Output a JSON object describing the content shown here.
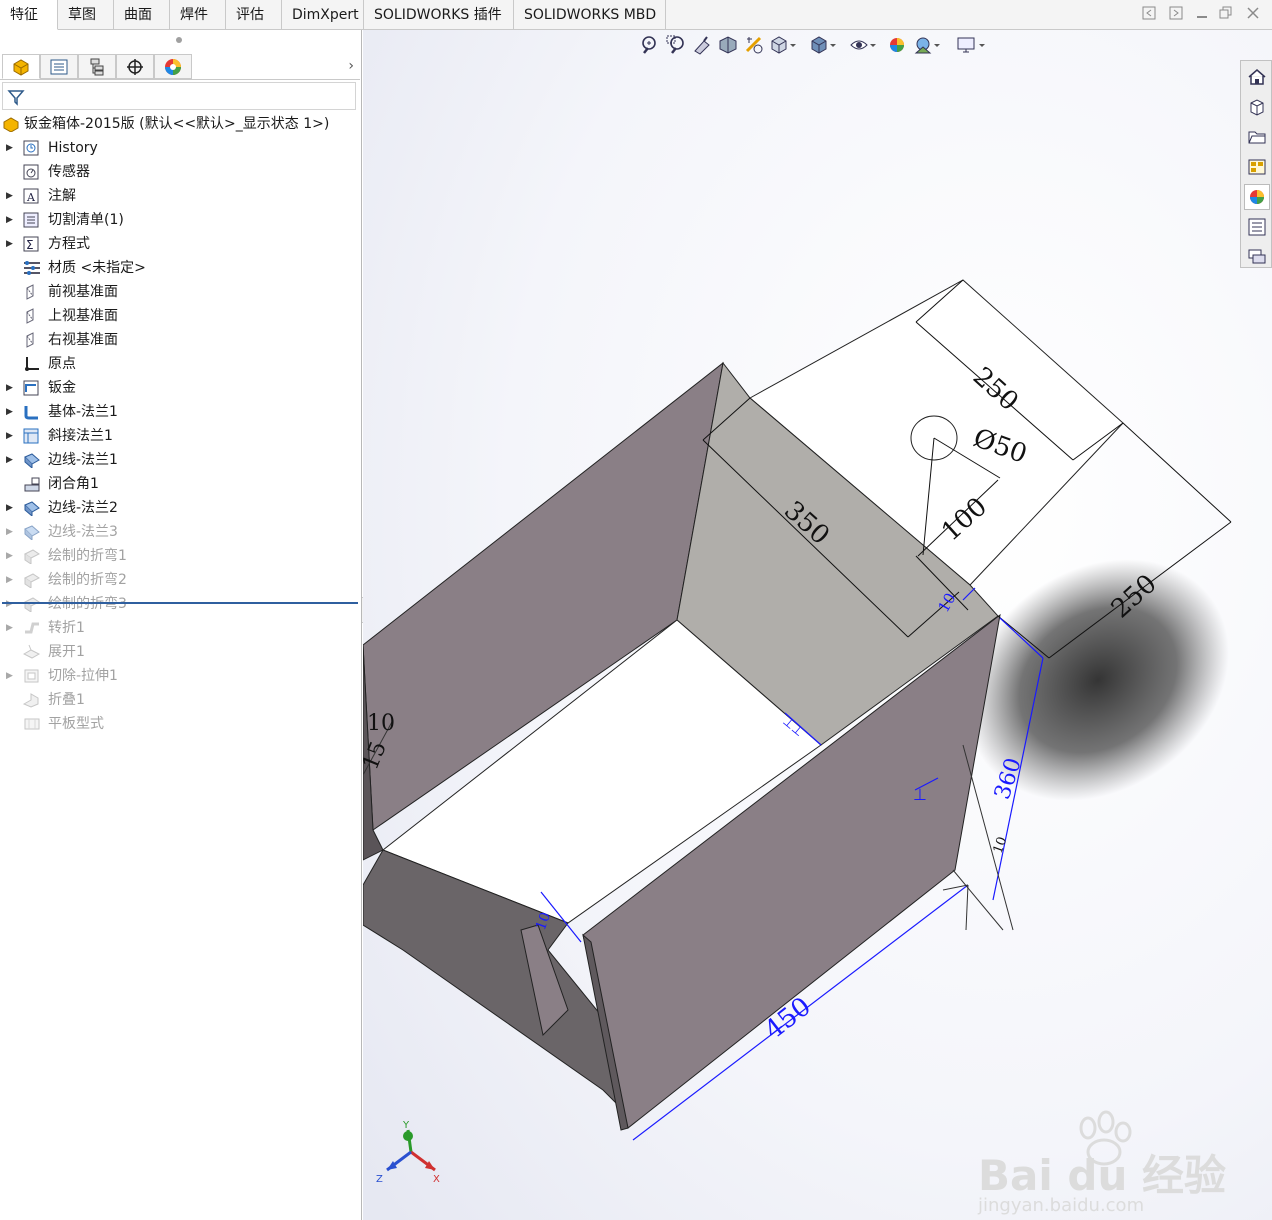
{
  "tabs": [
    {
      "label": "特征",
      "active": true
    },
    {
      "label": "草图",
      "active": false
    },
    {
      "label": "曲面",
      "active": false
    },
    {
      "label": "焊件",
      "active": false
    },
    {
      "label": "评估",
      "active": false
    },
    {
      "label": "DimXpert",
      "active": false
    },
    {
      "label": "SOLIDWORKS 插件",
      "active": false
    },
    {
      "label": "SOLIDWORKS MBD",
      "active": false
    }
  ],
  "window_controls": [
    "restore-left-icon",
    "restore-right-icon",
    "restore-icon",
    "close-icon"
  ],
  "manager_tabs": [
    "feature-manager-icon",
    "property-manager-icon",
    "configuration-manager-icon",
    "dimxpert-manager-icon",
    "display-manager-icon"
  ],
  "tree": {
    "root_label": "钣金箱体-2015版  (默认<<默认>_显示状态 1>)",
    "items": [
      {
        "label": "History",
        "icon": "history-icon",
        "arrow": true,
        "suppressed": false
      },
      {
        "label": "传感器",
        "icon": "sensor-icon",
        "arrow": false,
        "suppressed": false
      },
      {
        "label": "注解",
        "icon": "annotation-icon",
        "arrow": true,
        "suppressed": false
      },
      {
        "label": "切割清单(1)",
        "icon": "cut-list-icon",
        "arrow": true,
        "suppressed": false
      },
      {
        "label": "方程式",
        "icon": "equation-icon",
        "arrow": true,
        "suppressed": false
      },
      {
        "label": "材质 <未指定>",
        "icon": "material-icon",
        "arrow": false,
        "suppressed": false
      },
      {
        "label": "前视基准面",
        "icon": "plane-icon",
        "arrow": false,
        "suppressed": false
      },
      {
        "label": "上视基准面",
        "icon": "plane-icon",
        "arrow": false,
        "suppressed": false
      },
      {
        "label": "右视基准面",
        "icon": "plane-icon",
        "arrow": false,
        "suppressed": false
      },
      {
        "label": "原点",
        "icon": "origin-icon",
        "arrow": false,
        "suppressed": false
      },
      {
        "label": "钣金",
        "icon": "sheet-metal-icon",
        "arrow": true,
        "suppressed": false
      },
      {
        "label": "基体-法兰1",
        "icon": "base-flange-icon",
        "arrow": true,
        "suppressed": false
      },
      {
        "label": "斜接法兰1",
        "icon": "miter-flange-icon",
        "arrow": true,
        "suppressed": false
      },
      {
        "label": "边线-法兰1",
        "icon": "edge-flange-icon",
        "arrow": true,
        "suppressed": false
      },
      {
        "label": "闭合角1",
        "icon": "closed-corner-icon",
        "arrow": false,
        "suppressed": false
      },
      {
        "label": "边线-法兰2",
        "icon": "edge-flange-icon",
        "arrow": true,
        "suppressed": false
      },
      {
        "label": "边线-法兰3",
        "icon": "edge-flange-icon",
        "arrow": true,
        "suppressed": true
      },
      {
        "label": "绘制的折弯1",
        "icon": "sketched-bend-icon",
        "arrow": true,
        "suppressed": true
      },
      {
        "label": "绘制的折弯2",
        "icon": "sketched-bend-icon",
        "arrow": true,
        "suppressed": true
      },
      {
        "label": "绘制的折弯3",
        "icon": "sketched-bend-icon",
        "arrow": true,
        "suppressed": true
      },
      {
        "label": "转折1",
        "icon": "jog-icon",
        "arrow": true,
        "suppressed": true
      },
      {
        "label": "展开1",
        "icon": "unfold-icon",
        "arrow": false,
        "suppressed": true
      },
      {
        "label": "切除-拉伸1",
        "icon": "cut-extrude-icon",
        "arrow": true,
        "suppressed": true
      },
      {
        "label": "折叠1",
        "icon": "fold-icon",
        "arrow": false,
        "suppressed": true
      },
      {
        "label": "平板型式",
        "icon": "flat-pattern-icon",
        "arrow": false,
        "suppressed": true
      }
    ]
  },
  "view_toolbar": [
    "zoom-to-fit-icon",
    "zoom-to-area-icon",
    "previous-view-icon",
    "section-view-icon",
    "dynamic-annotation-icon",
    "view-orientation-icon",
    "display-style-icon",
    "hide-show-icon",
    "edit-appearance-icon",
    "apply-scene-icon",
    "view-settings-icon"
  ],
  "task_pane": [
    "home-icon",
    "design-library-icon",
    "file-explorer-icon",
    "view-palette-icon",
    "appearances-icon",
    "custom-properties-icon",
    "forum-icon"
  ],
  "dimensions": {
    "d1": "250",
    "d2": "Ø50",
    "d3": "100",
    "d4": "350",
    "d5": "250",
    "d6": "10",
    "d7": "15",
    "d8": "10",
    "d9": "360",
    "d10": "450",
    "d11": "10",
    "d12": "10"
  },
  "triad": {
    "x": "X",
    "y": "Y",
    "z": "Z"
  },
  "watermark": {
    "brand": "Bai du 经验",
    "url": "jingyan.baidu.com"
  },
  "colors": {
    "panel_face": "#8a7f86",
    "inner_face": "#b0aeaa",
    "dim_blue": "#1a1aff",
    "rollback": "#2f5f9f"
  }
}
